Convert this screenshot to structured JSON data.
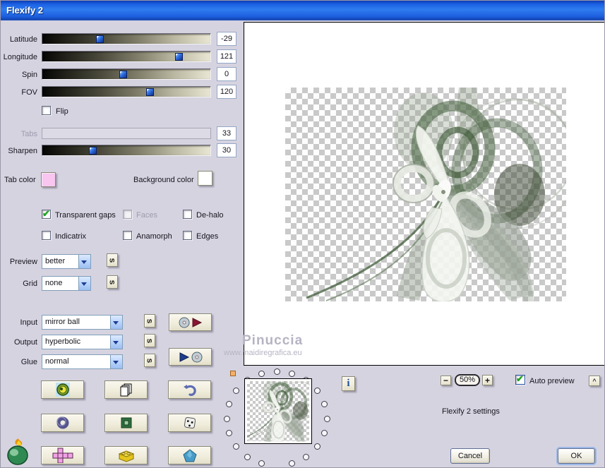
{
  "titlebar": {
    "title": "Flexify 2"
  },
  "sliders": {
    "latitude": {
      "label": "Latitude",
      "value": "-29",
      "pos": 0.34
    },
    "longitude": {
      "label": "Longitude",
      "value": "121",
      "pos": 0.81
    },
    "spin": {
      "label": "Spin",
      "value": "0",
      "pos": 0.48
    },
    "fov": {
      "label": "FOV",
      "value": "120",
      "pos": 0.64
    },
    "tabs": {
      "label": "Tabs",
      "value": "33",
      "disabled": true
    },
    "sharpen": {
      "label": "Sharpen",
      "value": "30",
      "pos": 0.3
    }
  },
  "flip": {
    "label": "Flip",
    "checked": false
  },
  "colors": {
    "tab_color_label": "Tab color",
    "tab_color": "#f8c6ef",
    "background_color_label": "Background color",
    "background_color": "#ffffff",
    "check_green": "#1ea21e"
  },
  "checkboxes": {
    "transparent_gaps": {
      "label": "Transparent gaps",
      "checked": true
    },
    "faces": {
      "label": "Faces",
      "checked": false,
      "disabled": true
    },
    "de_halo": {
      "label": "De-halo",
      "checked": false
    },
    "indicatrix": {
      "label": "Indicatrix",
      "checked": false
    },
    "anamorph": {
      "label": "Anamorph",
      "checked": false
    },
    "edges": {
      "label": "Edges",
      "checked": false
    }
  },
  "dropdowns": {
    "preview": {
      "label": "Preview",
      "value": "better"
    },
    "grid": {
      "label": "Grid",
      "value": "none"
    },
    "input": {
      "label": "Input",
      "value": "mirror ball"
    },
    "output": {
      "label": "Output",
      "value": "hyperbolic"
    },
    "glue": {
      "label": "Glue",
      "value": "normal"
    }
  },
  "icons": {
    "seed": "s",
    "info": "i",
    "check": "✔",
    "zoom_out": "−",
    "zoom_in": "+",
    "collapse": "^"
  },
  "zoombar": {
    "zoom_level": "50%",
    "auto_preview_label": "Auto preview",
    "auto_preview_checked": true
  },
  "status_text": "Flexify 2 settings",
  "actions": {
    "cancel": "Cancel",
    "ok": "OK"
  },
  "watermark": {
    "line1": "Pinuccia",
    "line2": "www.maidiregrafica.eu"
  }
}
